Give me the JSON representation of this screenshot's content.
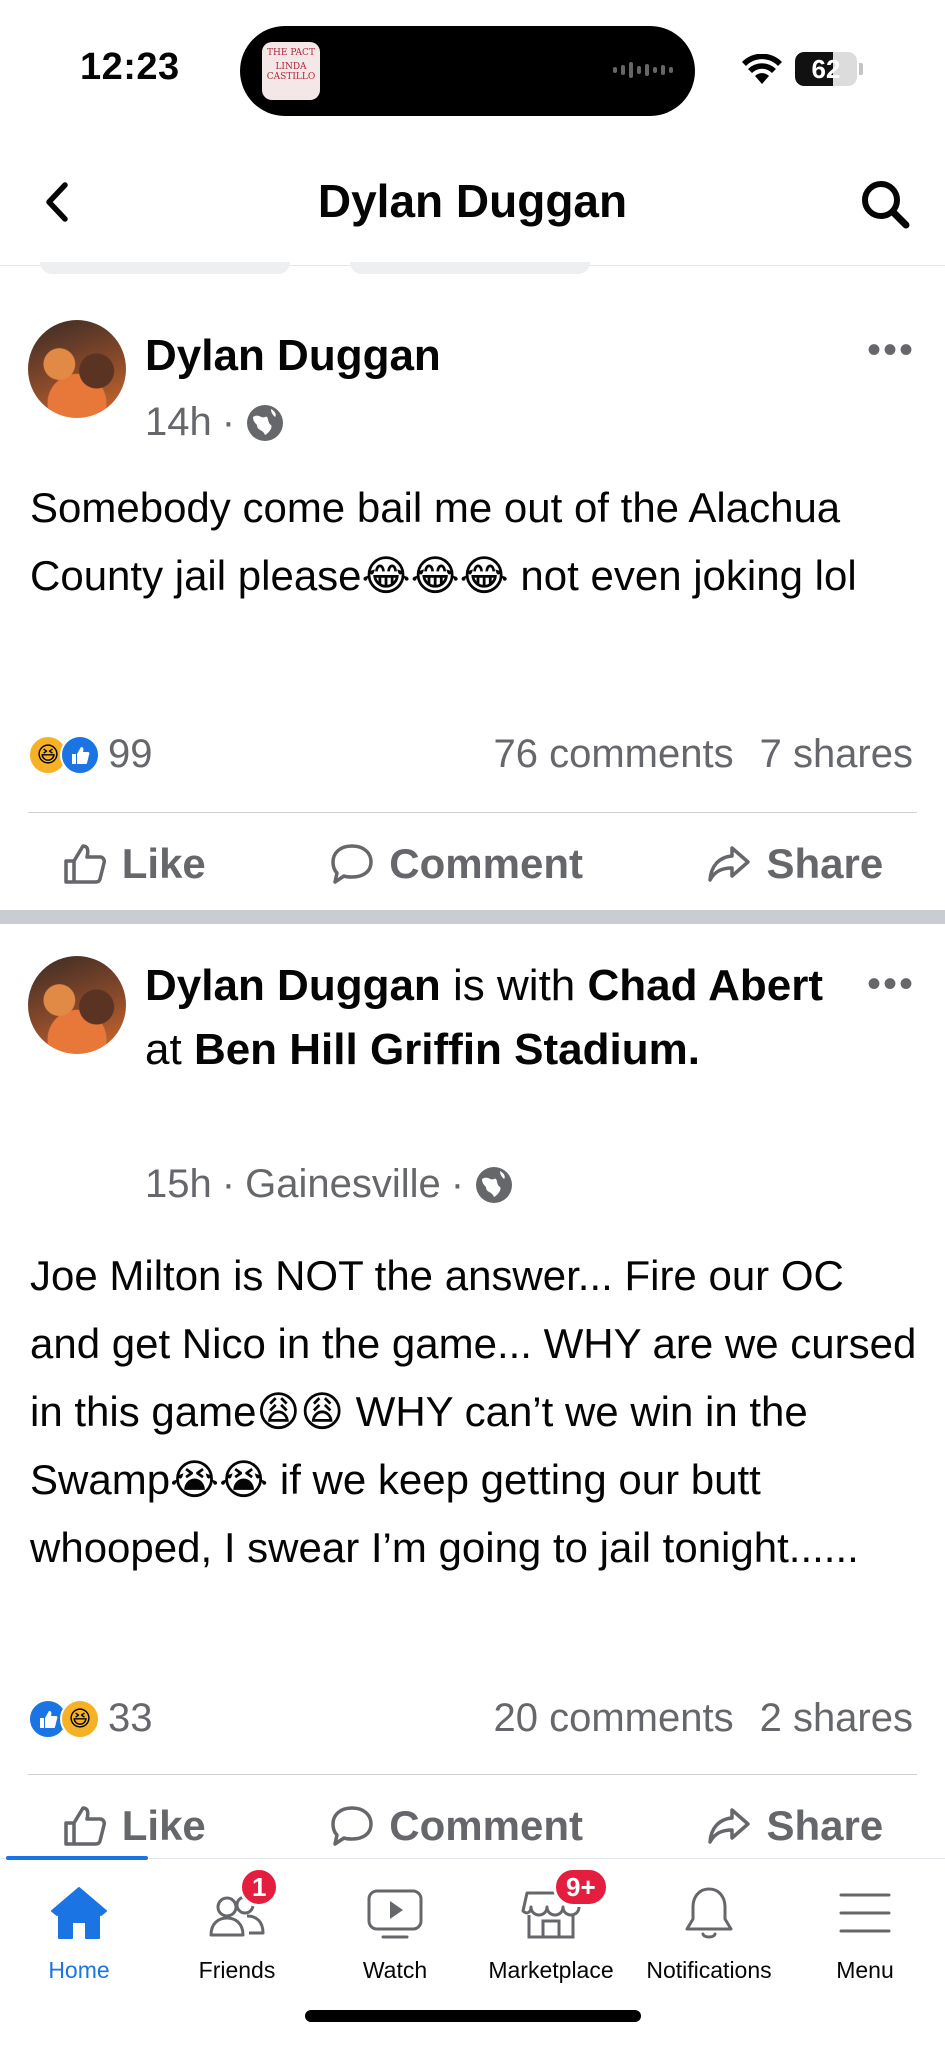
{
  "status_bar": {
    "time": "12:23",
    "island_thumbnail_lines": [
      "THE PACT",
      "LINDA",
      "CASTILLO"
    ],
    "battery_percent": 62,
    "battery_label": "62"
  },
  "header": {
    "title": "Dylan Duggan",
    "back_icon": "chevron-left-icon",
    "search_icon": "search-icon"
  },
  "posts": [
    {
      "author": "Dylan Duggan",
      "time": "14h",
      "separator": "·",
      "audience_icon": "globe-icon",
      "more": "•••",
      "text": "Somebody come bail me out of the Alachua County jail please😂😂😂 not even joking lol",
      "reaction_count": "99",
      "comments": "76 comments",
      "shares": "7 shares",
      "actions": {
        "like": "Like",
        "comment": "Comment",
        "share": "Share"
      }
    },
    {
      "author": "Dylan Duggan",
      "with_word": "is with",
      "tagged": "Chad Abert",
      "at_word": "at",
      "place": "Ben Hill Griffin Stadium",
      "period": ".",
      "time": "15h",
      "separator": "·",
      "location": "Gainesville",
      "audience_icon": "globe-icon",
      "more": "•••",
      "text": "Joe Milton is NOT the answer... Fire our OC and get Nico in the game... WHY are we cursed in this game😩😩 WHY can’t we win in the Swamp😭😭 if we keep getting our butt whooped, I swear I’m going to jail tonight......",
      "reaction_count": "33",
      "comments": "20 comments",
      "shares": "2 shares",
      "actions": {
        "like": "Like",
        "comment": "Comment",
        "share": "Share"
      }
    }
  ],
  "tab_bar": {
    "tabs": [
      {
        "label": "Home",
        "icon": "home-icon",
        "active": true
      },
      {
        "label": "Friends",
        "icon": "friends-icon",
        "badge": "1"
      },
      {
        "label": "Watch",
        "icon": "watch-icon"
      },
      {
        "label": "Marketplace",
        "icon": "marketplace-icon",
        "badge": "9+"
      },
      {
        "label": "Notifications",
        "icon": "bell-icon"
      },
      {
        "label": "Menu",
        "icon": "menu-icon"
      }
    ]
  },
  "colors": {
    "accent": "#1b74e4",
    "badge": "#e41e3f",
    "secondary_text": "#65676b",
    "haha_reaction": "#f7b125"
  }
}
